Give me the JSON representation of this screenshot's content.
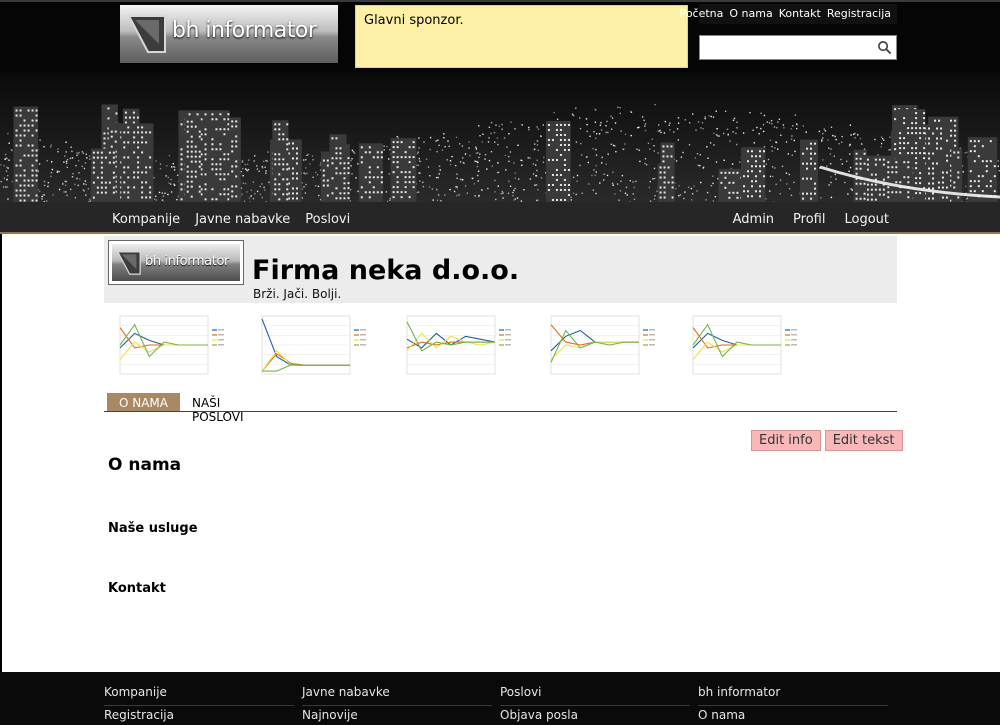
{
  "header": {
    "logo_text": "bh informator",
    "sponsor_text": "Glavni sponzor.",
    "top_links": [
      "Početna",
      "O nama",
      "Kontakt",
      "Registracija"
    ],
    "search": {
      "value": "",
      "placeholder": ""
    }
  },
  "main_nav": {
    "left": [
      "Kompanije",
      "Javne nabavke",
      "Poslovi"
    ],
    "right": [
      "Admin",
      "Profil",
      "Logout"
    ]
  },
  "company": {
    "logo_text": "bh informator",
    "name": "Firma neka d.o.o.",
    "slogan": "Brži. Jači. Bolji."
  },
  "tabs": {
    "active": "O NAMA",
    "other": "NAŠI POSLOVI"
  },
  "actions": {
    "edit_info": "Edit info",
    "edit_text": "Edit tekst"
  },
  "content": {
    "about_title": "O nama",
    "services_title": "Naše usluge",
    "contact_title": "Kontakt"
  },
  "footer": {
    "columns": [
      [
        "Kompanije",
        "Registracija"
      ],
      [
        "Javne nabavke",
        "Najnovije"
      ],
      [
        "Poslovi",
        "Objava posla"
      ],
      [
        "bh informator",
        "O nama"
      ]
    ]
  },
  "colors": {
    "sponsor_bg": "#fdf0a6",
    "tab_active": "#a88963",
    "button_bg": "#f9b8b8",
    "nav_bg": "#262626"
  }
}
